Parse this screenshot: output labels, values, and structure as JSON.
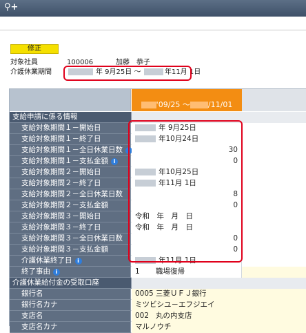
{
  "toolbar": {
    "glyph": "⚲+"
  },
  "edit_button": "修正",
  "employee": {
    "label": "対象社員",
    "code": "100006",
    "name": "加藤　恭子"
  },
  "leave_period": {
    "label": "介護休業期間",
    "start": "年 9月25日 ～",
    "end": "年11月 1日"
  },
  "column_header": {
    "start": "'09/25 ～",
    "end": "/11/01"
  },
  "sections": {
    "benefit": "支給申請に係る情報",
    "account": "介護休業給付金の受取口座"
  },
  "rows": [
    {
      "label": "支給対象期間１－開始日",
      "value": "年  9月25日",
      "masked": true
    },
    {
      "label": "支給対象期間１－終了日",
      "value": "年10月24日",
      "masked": true
    },
    {
      "label": "支給対象期間１－全日休業日数",
      "value": "30",
      "align": "right",
      "info": true
    },
    {
      "label": "支給対象期間１－支払金額",
      "value": "0",
      "align": "right",
      "info": true
    },
    {
      "label": "支給対象期間２－開始日",
      "value": "年10月25日",
      "masked": true
    },
    {
      "label": "支給対象期間２－終了日",
      "value": "年11月  1日",
      "masked": true
    },
    {
      "label": "支給対象期間２－全日休業日数",
      "value": "8",
      "align": "right"
    },
    {
      "label": "支給対象期間２－支払金額",
      "value": "0",
      "align": "right"
    },
    {
      "label": "支給対象期間３－開始日",
      "value": "令和　年　月　日"
    },
    {
      "label": "支給対象期間３－終了日",
      "value": "令和　年　月　日"
    },
    {
      "label": "支給対象期間３－全日休業日数",
      "value": "0",
      "align": "right"
    },
    {
      "label": "支給対象期間３－支払金額",
      "value": "0",
      "align": "right"
    },
    {
      "label": "介護休業終了日",
      "value": "年11月  1日",
      "masked": true,
      "info": true
    }
  ],
  "end_reason": {
    "label": "終了事由",
    "code": "1",
    "value": "職場復帰"
  },
  "bank": [
    {
      "label": "銀行名",
      "code": "0005",
      "value": "三菱ＵＦＪ銀行"
    },
    {
      "label": "銀行名カナ",
      "code": "",
      "value": "ミツビシユ－エフジエイ"
    },
    {
      "label": "支店名",
      "code": "002",
      "value": "丸の内支店"
    },
    {
      "label": "支店名カナ",
      "code": "",
      "value": "マルノウチ"
    }
  ],
  "colors": {
    "highlight": "#e0001b",
    "header_orange": "#f38d12",
    "label_bg": "#5f6e82",
    "edit_yellow": "#f5e000"
  }
}
